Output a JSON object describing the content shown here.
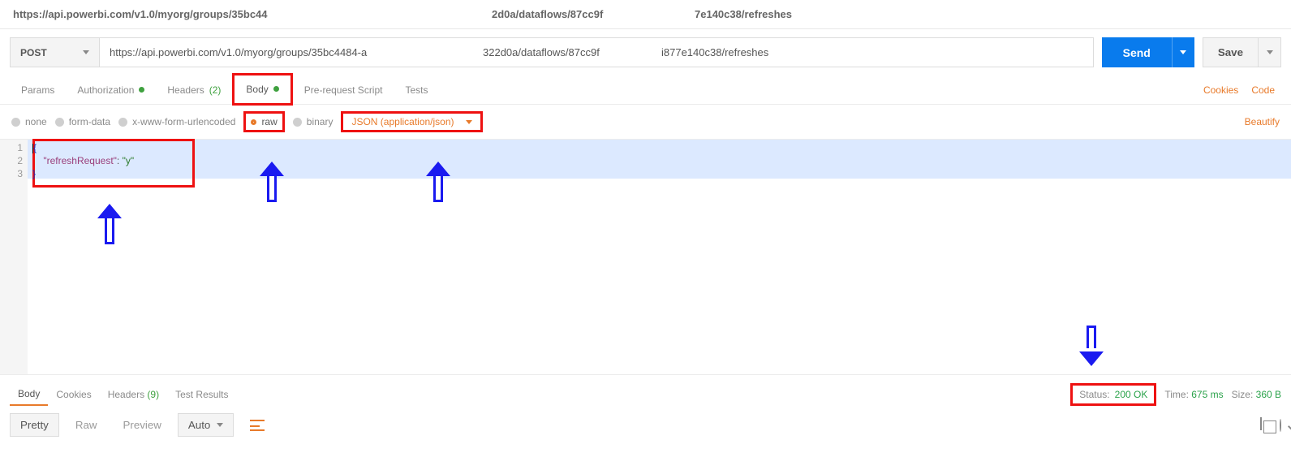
{
  "topUrl": {
    "seg1": "https://api.powerbi.com/v1.0/myorg/groups/35bc44",
    "seg2": "2d0a/dataflows/87cc9f",
    "seg3": "7e140c38/refreshes"
  },
  "request": {
    "method": "POST",
    "url_a": "https://api.powerbi.com/v1.0/myorg/groups/35bc4484-a",
    "url_b": "322d0a/dataflows/87cc9f",
    "url_c": "i877e140c38/refreshes",
    "send": "Send",
    "save": "Save"
  },
  "tabs": {
    "params": "Params",
    "auth": "Authorization",
    "headers": "Headers",
    "headersCount": "(2)",
    "body": "Body",
    "prereq": "Pre-request Script",
    "tests": "Tests",
    "cookies": "Cookies",
    "code": "Code"
  },
  "bodyOpts": {
    "none": "none",
    "formdata": "form-data",
    "xwww": "x-www-form-urlencoded",
    "raw": "raw",
    "binary": "binary",
    "json": "JSON (application/json)",
    "beautify": "Beautify"
  },
  "editor": {
    "line1": "{",
    "line2key": "\"refreshRequest\"",
    "line2sep": ": ",
    "line2val": "\"y\"",
    "line3": "}",
    "ln1": "1",
    "ln2": "2",
    "ln3": "3"
  },
  "respTabs": {
    "body": "Body",
    "cookies": "Cookies",
    "headers": "Headers",
    "headersCount": "(9)",
    "tests": "Test Results"
  },
  "status": {
    "label": "Status:",
    "value": "200 OK",
    "timeLabel": "Time:",
    "time": "675 ms",
    "sizeLabel": "Size:",
    "size": "360 B"
  },
  "respToolbar": {
    "pretty": "Pretty",
    "raw": "Raw",
    "preview": "Preview",
    "auto": "Auto"
  }
}
